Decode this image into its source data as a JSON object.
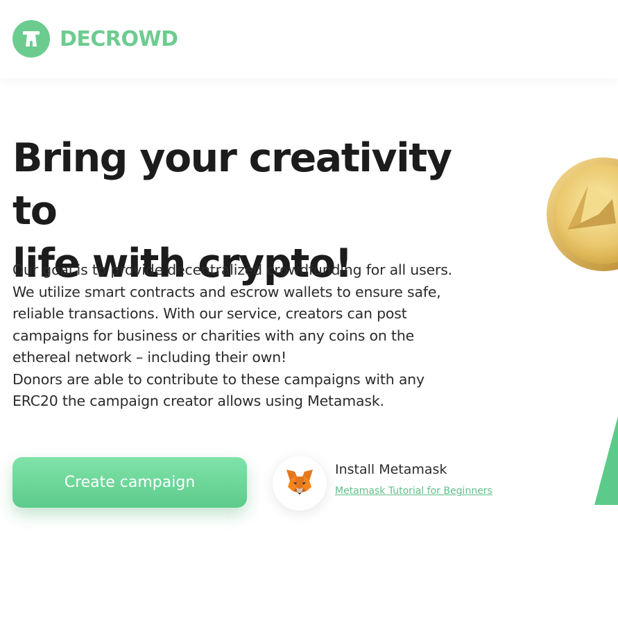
{
  "brand": {
    "name": "DECROWD",
    "color": "#6ccc8f",
    "icon": "tower-gate-icon"
  },
  "hero": {
    "headline_line1": "Bring your creativity to",
    "headline_line2": "life with crypto!",
    "description_line1": "Our goal is to provide decentralized crowdfunding for all users.",
    "description_line2": "We utilize smart contracts and escrow wallets to ensure safe,",
    "description_line3": "reliable transactions. With our service, creators can post",
    "description_line4": "campaigns for business or charities with any coins on the",
    "description_line5": "ethereal network – including their own!",
    "description_line6": "Donors are able to contribute to these campaigns with any",
    "description_line7": "ERC20 the campaign creator allows using Metamask."
  },
  "actions": {
    "create_campaign_label": "Create campaign",
    "button_gradient_top": "#80e3a9",
    "button_gradient_bottom": "#5ccb8a"
  },
  "metamask": {
    "title": "Install Metamask",
    "tutorial_link": "Metamask Tutorial for Beginners",
    "link_color": "#5fbf86",
    "icon": "metamask-fox-icon"
  },
  "decor": {
    "coin_icon": "ethereum-coin-icon",
    "pyramid_icon": "green-pyramid-icon",
    "pyramid_color": "#5ccb8a"
  }
}
